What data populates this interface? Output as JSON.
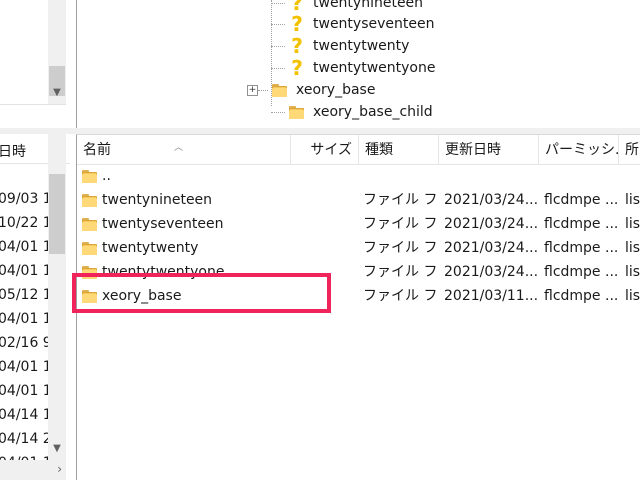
{
  "tree": {
    "items": [
      {
        "label": "twentynineteen",
        "icon": "question-icon",
        "expander": ""
      },
      {
        "label": "twentyseventeen",
        "icon": "question-icon",
        "expander": ""
      },
      {
        "label": "twentytwenty",
        "icon": "question-icon",
        "expander": ""
      },
      {
        "label": "twentytwentyone",
        "icon": "question-icon",
        "expander": ""
      },
      {
        "label": "xeory_base",
        "icon": "folder-icon",
        "expander": "+"
      },
      {
        "label": "xeory_base_child",
        "icon": "folder-icon",
        "expander": ""
      }
    ]
  },
  "left_list": {
    "header": "日時",
    "dates": [
      "09/03 1",
      "10/22 1",
      "04/01 1",
      "04/01 1",
      "05/12 1",
      "04/01 1",
      "02/16 9",
      "04/01 1",
      "04/01 1",
      "04/14 1",
      "04/14 2",
      "04/01 1"
    ]
  },
  "file_list": {
    "columns": {
      "name": "名前",
      "size": "サイズ",
      "type": "種類",
      "modified": "更新日時",
      "permissions": "パーミッシ...",
      "owner": "所"
    },
    "rows": [
      {
        "name": "..",
        "type": "",
        "modified": "",
        "permissions": "",
        "owner": ""
      },
      {
        "name": "twentynineteen",
        "type": "ファイル フ...",
        "modified": "2021/03/24...",
        "permissions": "flcdmpe ...",
        "owner": "list"
      },
      {
        "name": "twentyseventeen",
        "type": "ファイル フ...",
        "modified": "2021/03/24...",
        "permissions": "flcdmpe ...",
        "owner": "list"
      },
      {
        "name": "twentytwenty",
        "type": "ファイル フ...",
        "modified": "2021/03/24...",
        "permissions": "flcdmpe ...",
        "owner": "list"
      },
      {
        "name": "twentytwentyone",
        "type": "ファイル フ...",
        "modified": "2021/03/24...",
        "permissions": "flcdmpe ...",
        "owner": "list"
      },
      {
        "name": "xeory_base",
        "type": "ファイル フ...",
        "modified": "2021/03/11...",
        "permissions": "flcdmpe ...",
        "owner": "list"
      }
    ]
  },
  "colors": {
    "highlight": "#f0245a",
    "folder": "#f6c85c"
  }
}
